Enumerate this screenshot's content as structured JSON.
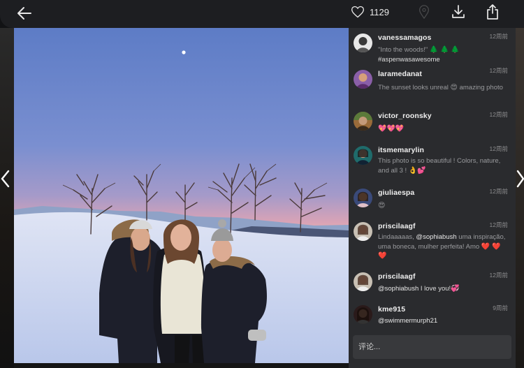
{
  "toolbar": {
    "back_icon": "arrow-left-icon",
    "like_icon": "heart-icon",
    "like_count": "1129",
    "location_icon": "map-pin-icon",
    "download_icon": "download-icon",
    "share_icon": "share-icon"
  },
  "navigation": {
    "prev_icon": "chevron-left-icon",
    "next_icon": "chevron-right-icon"
  },
  "photo": {
    "description_icon": "photo"
  },
  "comments": [
    {
      "username": "vanessamagos",
      "time": "12周前",
      "text_parts": [
        "\"Into the woods!\" ",
        "🌲 🌲 🌲",
        " #aspenwasawesome"
      ]
    },
    {
      "username": "laramedanat",
      "time": "12周前",
      "text_parts": [
        "The sunset looks unreal ",
        "😍",
        " amazing photo"
      ]
    },
    {
      "username": "victor_roonsky",
      "time": "12周前",
      "text_parts": [
        "💖💖💖"
      ]
    },
    {
      "username": "itsmemarylin",
      "time": "12周前",
      "text_parts": [
        "This photo is so beautiful ! Colors, nature, and all 3 ! ",
        "👌💕"
      ]
    },
    {
      "username": "giuliaespa",
      "time": "12周前",
      "text_parts": [
        "😍"
      ]
    },
    {
      "username": "priscilaagf",
      "time": "12周前",
      "text_parts": [
        "Lindaaaaas, ",
        "@sophiabush",
        " uma inspiração, uma boneca, mulher perfeita! Amo ",
        "❤️ ❤️ ❤️"
      ]
    },
    {
      "username": "priscilaagf",
      "time": "12周前",
      "text_parts": [
        "@sophiabush",
        " I love you!",
        "💞"
      ]
    },
    {
      "username": "kme915",
      "time": "9周前",
      "text_parts": [
        "@swimmermurph21"
      ]
    }
  ],
  "comment_input": {
    "placeholder": "评论..."
  },
  "colors": {
    "panel_bg": "#2a2b2e",
    "toolbar_bg": "#1d1e21",
    "input_bg": "#38393c"
  }
}
